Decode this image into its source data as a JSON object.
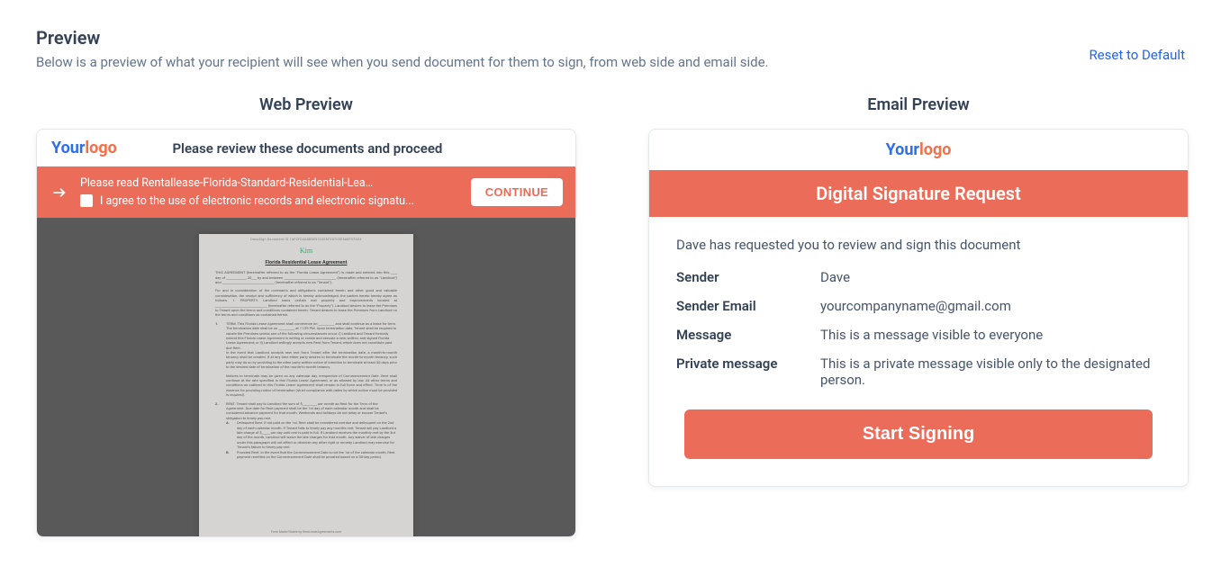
{
  "header": {
    "title": "Preview",
    "subtitle": "Below is a preview of what your recipient will see when you send document for them to sign, from web side and email side.",
    "reset_link": "Reset to Default"
  },
  "logo": {
    "your": "Your",
    "logo": "logo"
  },
  "web": {
    "col_title": "Web Preview",
    "top_title": "Please review these documents and proceed",
    "bar_line1": "Please read Rentallease-Florida-Standard-Residential-Lease-Agr...",
    "bar_line2": "I agree to the use of electronic records and electronic signatu...",
    "continue": "CONTINUE",
    "doc": {
      "meta": "DocuSign Document ID 1AFCFD4A8B8E51C3E8F3D7C3E8A8F57D24",
      "sig": "Kim",
      "heading": "Florida Residential Lease Agreement",
      "p1": "THIS AGREEMENT (hereinafter referred to as the \"Florida Lease Agreement\") is made and entered into this ____ day of ____________, 20___ by and between ________________________________ (hereinafter referred to as \"Landlord\") and ________________________________ (hereinafter referred to as \"Tenant\").",
      "p2": "For and in consideration of the covenants and obligations contained herein and other good and valuable consideration, the receipt and sufficiency of which is hereby acknowledged, the parties hereto hereby agree as follows. 1. PROPERTY. Landlord owns certain real property and improvements located at ________________________________ (hereinafter referred to as the \"Property\"). Landlord desires to lease the Premises to Tenant upon the terms and conditions contained herein. Tenant desires to lease the Premises from Landlord on the terms and conditions as contained herein.",
      "n1": "1.",
      "t1": "TERM. This Florida Lease Agreement shall commence on __________ and shall continue as a lease for term. The termination date shall be on __________ at 11:59 PM. Upon termination date, Tenant shall be required to vacate the Premises unless one of the following circumstances occur: i) Landlord and Tenant formally extend this Florida Lease Agreement in writing or create and execute a new, written, and signed Florida Lease Agreement; or ii) Landlord willingly accepts new Rent from Tenant, which does not constitute past due Rent.",
      "t1b": "In the event that Landlord accepts new rent from Tenant after the termination date, a month-to-month tenancy shall be created. If at any time either party desires to terminate the month-to-month tenancy, such party may do so by providing to the other party written notice of intention to terminate at least 30 days prior to the desired date of termination of the month-to-month tenancy.",
      "t1c": "Notices to terminate may be given on any calendar day, irrespective of Commencement Date. Rent shall continue at the rate specified in this Florida Lease Agreement, or as allowed by law. All other terms and conditions as outlined in this Florida Lease Agreement shall remain in full force and effect. Time is of the essence for providing notice of termination (strict compliance with dates by which notice must be provided is required).",
      "n2": "2.",
      "t2": "RENT. Tenant shall pay to Landlord the sum of $_________ per month as Rent for the Term of the Agreement. Due date for Rent payment shall be the 1st day of each calendar month and shall be considered advance payment for that month. Weekends and holidays do not delay or excuse Tenant's obligation to timely pay rent.",
      "n3": "A.",
      "t3": "Delinquent Rent. If not paid on the 1st, Rent shall be considered overdue and delinquent on the 2nd day of each calendar month. If Tenant fails to timely pay any month's rent, Tenant will pay Landlord a late charge of $_____ per day until rent is paid in full. If Landlord receives the monthly rent by the 3rd day of the month, Landlord will waive the late charges for that month. Any waiver of late charges under this paragraph will not affect or diminish any other right or remedy Landlord may exercise for Tenant's failure to timely pay rent.",
      "n4": "B.",
      "t4": "Prorated Rent. In the event that the Commencement Date is not the 1st of the calendar month, Rent payment remitted on the Commencement Date shall be prorated based on a 30-day period.",
      "footer": "Form Made Fillable by RentLeaseAgreements.com"
    }
  },
  "email": {
    "col_title": "Email Preview",
    "dsr": "Digital Signature Request",
    "intro": "Dave has requested you to review and sign this document",
    "rows": {
      "sender_lbl": "Sender",
      "sender_val": "Dave",
      "sender_email_lbl": "Sender Email",
      "sender_email_val": "yourcompanyname@gmail.com",
      "message_lbl": "Message",
      "message_val": "This is a message visible to everyone",
      "private_lbl": "Private message",
      "private_val": "This is a private message visible only to the designated person."
    },
    "start": "Start Signing"
  }
}
